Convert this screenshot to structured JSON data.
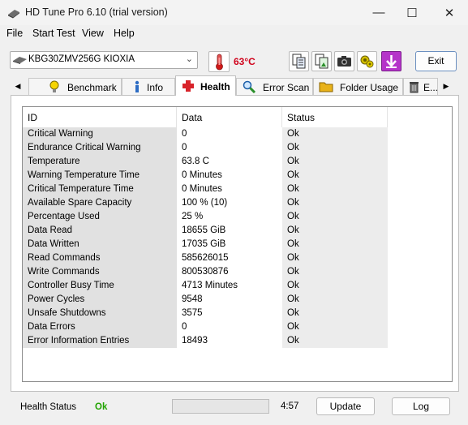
{
  "window": {
    "title": "HD Tune Pro 6.10 (trial version)",
    "controls": {
      "minimize": "—",
      "maximize": "☐",
      "close": "✕"
    }
  },
  "menu": [
    "File",
    "Start Test",
    "View",
    "Help"
  ],
  "toolbar": {
    "drive": "KBG30ZMV256G KIOXIA",
    "temperature": "63°C",
    "exit_label": "Exit",
    "icons": [
      "copy-text-icon",
      "copy-screenshot-icon",
      "camera-icon",
      "options-icon",
      "save-icon"
    ]
  },
  "tabs": [
    {
      "label": "Benchmark",
      "icon": "lightbulb-icon"
    },
    {
      "label": "Info",
      "icon": "info-icon"
    },
    {
      "label": "Health",
      "icon": "health-cross-icon",
      "active": true
    },
    {
      "label": "Error Scan",
      "icon": "magnifier-icon"
    },
    {
      "label": "Folder Usage",
      "icon": "folder-icon"
    },
    {
      "label": "E...",
      "icon": "trash-icon"
    }
  ],
  "health_table": {
    "columns": [
      "ID",
      "Data",
      "Status"
    ],
    "rows": [
      {
        "id": "Critical Warning",
        "data": "0",
        "status": "Ok"
      },
      {
        "id": "Endurance Critical Warning",
        "data": "0",
        "status": "Ok"
      },
      {
        "id": "Temperature",
        "data": "63.8 C",
        "status": "Ok"
      },
      {
        "id": "Warning Temperature Time",
        "data": "0 Minutes",
        "status": "Ok"
      },
      {
        "id": "Critical Temperature Time",
        "data": "0 Minutes",
        "status": "Ok"
      },
      {
        "id": "Available Spare Capacity",
        "data": "100 % (10)",
        "status": "Ok"
      },
      {
        "id": "Percentage Used",
        "data": "25 %",
        "status": "Ok"
      },
      {
        "id": "Data Read",
        "data": "18655 GiB",
        "status": "Ok"
      },
      {
        "id": "Data Written",
        "data": "17035 GiB",
        "status": "Ok"
      },
      {
        "id": "Read Commands",
        "data": "585626015",
        "status": "Ok"
      },
      {
        "id": "Write Commands",
        "data": "800530876",
        "status": "Ok"
      },
      {
        "id": "Controller Busy Time",
        "data": "4713 Minutes",
        "status": "Ok"
      },
      {
        "id": "Power Cycles",
        "data": "9548",
        "status": "Ok"
      },
      {
        "id": "Unsafe Shutdowns",
        "data": "3575",
        "status": "Ok"
      },
      {
        "id": "Data Errors",
        "data": "0",
        "status": "Ok"
      },
      {
        "id": "Error Information Entries",
        "data": "18493",
        "status": "Ok"
      }
    ]
  },
  "status_bar": {
    "health_label": "Health Status",
    "health_value": "Ok",
    "progress": 0,
    "time": "4:57",
    "update_label": "Update",
    "log_label": "Log"
  },
  "colors": {
    "temperature": "#d0021b",
    "health_ok": "#21a300",
    "progress_fill": "#06b025"
  }
}
